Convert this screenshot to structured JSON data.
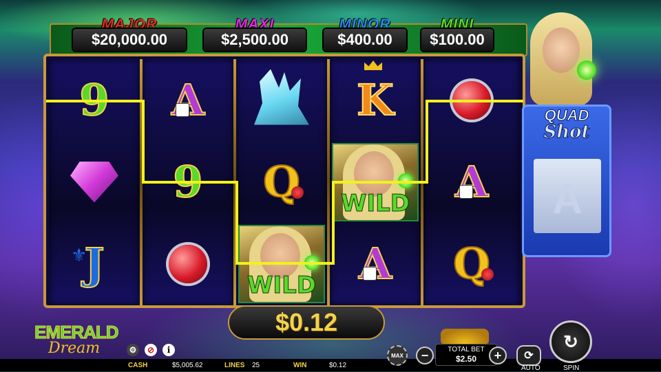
{
  "jackpots": [
    {
      "label": "MAJOR",
      "value": "$20,000.00",
      "color": "#e02a2a"
    },
    {
      "label": "MAXI",
      "value": "$2,500.00",
      "color": "#e02ae0"
    },
    {
      "label": "MINOR",
      "value": "$400.00",
      "color": "#2a8ae0"
    },
    {
      "label": "MINI",
      "value": "$100.00",
      "color": "#5bd82a"
    }
  ],
  "reels": [
    [
      "9",
      "pink-gem",
      "J"
    ],
    [
      "A",
      "9",
      "red-gem"
    ],
    [
      "crystal",
      "Q",
      "WILD"
    ],
    [
      "K",
      "WILD",
      "A"
    ],
    [
      "red-gem",
      "A",
      "Q"
    ]
  ],
  "wild_label": "WILD",
  "quad_shot": {
    "line1": "QUAD",
    "line2": "Shot"
  },
  "win_amount": "$0.12",
  "logo": {
    "line1": "EMERALD",
    "line2": "Dream"
  },
  "status": {
    "cash_label": "CASH",
    "cash_value": "$5,005.62",
    "lines_label": "LINES",
    "lines_value": "25",
    "win_label": "WIN",
    "win_value": "$0.12"
  },
  "controls": {
    "max_label": "MAX",
    "total_bet_label": "TOTAL BET",
    "total_bet_value": "$2.50",
    "minus_label": "−",
    "plus_label": "+",
    "auto_label": "AUTO",
    "spin_label": "SPIN"
  },
  "colors": {
    "payline": "#f2f21a",
    "frame": "#c89a3a",
    "accent_green": "#5bd82a"
  }
}
